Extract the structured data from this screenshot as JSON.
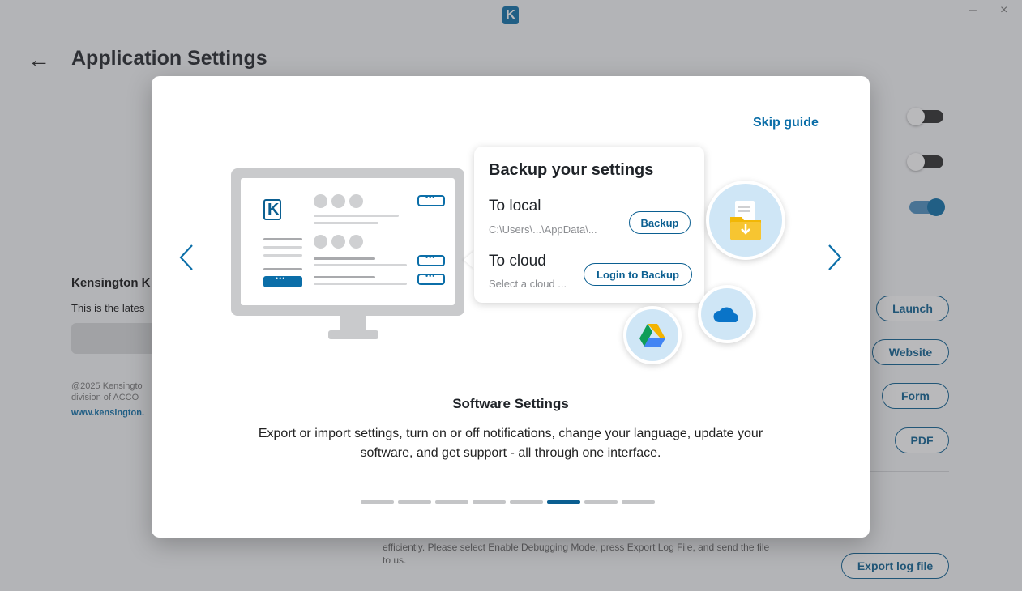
{
  "window": {
    "logo_letter": "K",
    "minimize": "–",
    "close": "×"
  },
  "header": {
    "back": "←",
    "title": "Application Settings"
  },
  "settings": {
    "toggles": [
      {
        "state": "off"
      },
      {
        "state": "off"
      },
      {
        "state": "on"
      }
    ],
    "about": {
      "company": "Kensington K",
      "latest": "This is the lates",
      "copyright_line1": "@2025 Kensingto",
      "copyright_line2": "division of ACCO",
      "website": "www.kensington."
    },
    "buttons": {
      "launch": "Launch",
      "website": "Website",
      "form": "Form",
      "pdf": "PDF",
      "export_log": "Export log file"
    },
    "debug_line1": "efficiently. Please select Enable Debugging Mode, press Export Log File, and send the file",
    "debug_line2": "to us."
  },
  "guide": {
    "skip": "Skip guide",
    "illustration": {
      "callout_title": "Backup your settings",
      "local_label": "To local",
      "local_path": "C:\\Users\\...\\AppData\\...",
      "backup_button": "Backup",
      "cloud_label": "To cloud",
      "cloud_placeholder": "Select a cloud ...",
      "login_button": "Login to Backup",
      "icons": [
        "folder-download-icon",
        "google-drive-icon",
        "onedrive-icon"
      ]
    },
    "slide_title": "Software Settings",
    "slide_desc_line1": "Export or import settings, turn on or off notifications, change your language, update your",
    "slide_desc_line2": "software, and get support - all through one interface.",
    "pager": {
      "total": 8,
      "active_index": 5
    }
  },
  "colors": {
    "accent": "#0b6ea8",
    "overlay": "rgba(70,72,76,0.38)"
  }
}
